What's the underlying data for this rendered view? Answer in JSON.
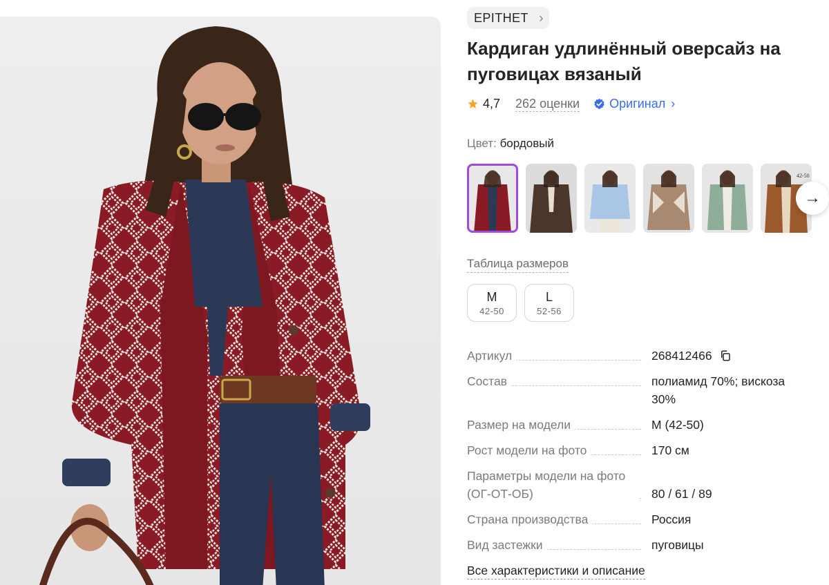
{
  "brand": {
    "name": "EPITHET",
    "chevron": "chevron-right-icon"
  },
  "product": {
    "title": "Кардиган удлинённый оверсайз на пуговицах вязаный"
  },
  "rating": {
    "value": "4,7",
    "reviews_label": "262 оценки",
    "star_icon": "star-icon",
    "star_color": "#f5a623"
  },
  "original": {
    "label": "Оригинал",
    "badge_icon": "check-badge-icon",
    "color": "#3a6ee8"
  },
  "color": {
    "label": "Цвет:",
    "value": "бордовый"
  },
  "thumbnails": {
    "selected_index": 0,
    "accent": "#a04be0",
    "items": [
      {
        "name": "thumb-burgundy"
      },
      {
        "name": "thumb-brown"
      },
      {
        "name": "thumb-lightblue"
      },
      {
        "name": "thumb-beige"
      },
      {
        "name": "thumb-green"
      },
      {
        "name": "thumb-caramel",
        "tag": "42-50"
      }
    ],
    "next_icon": "arrow-right-icon"
  },
  "sizes": {
    "table_link": "Таблица размеров",
    "options": [
      {
        "label": "M",
        "range": "42-50"
      },
      {
        "label": "L",
        "range": "52-56"
      }
    ]
  },
  "specs": [
    {
      "label": "Артикул",
      "value": "268412466",
      "copy_icon": "copy-icon"
    },
    {
      "label": "Состав",
      "value": "полиамид 70%; вискоза 30%"
    },
    {
      "label": "Размер на модели",
      "value": "M (42-50)"
    },
    {
      "label": "Рост модели на фото",
      "value": "170 см"
    },
    {
      "label": "Параметры модели на фото (ОГ-ОТ-ОБ)",
      "value": "80 / 61 / 89"
    },
    {
      "label": "Страна производства",
      "value": "Россия"
    },
    {
      "label": "Вид застежки",
      "value": "пуговицы"
    }
  ],
  "all_specs_link": "Все характеристики и описание"
}
